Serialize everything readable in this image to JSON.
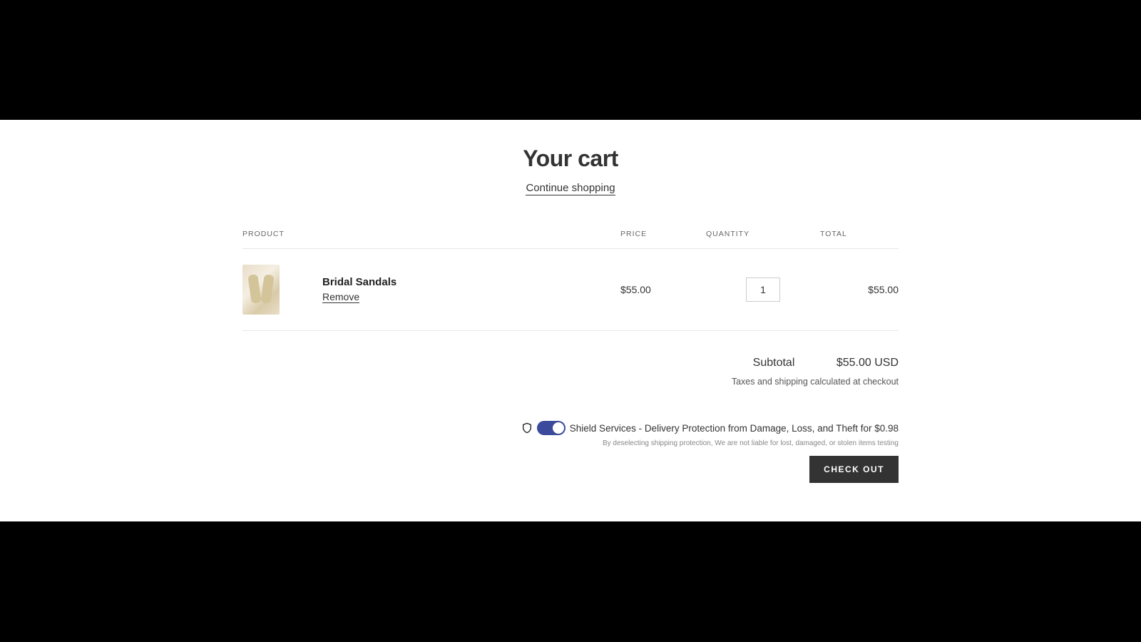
{
  "header": {
    "title": "Your cart",
    "continue_label": "Continue shopping"
  },
  "columns": {
    "product": "PRODUCT",
    "price": "PRICE",
    "quantity": "QUANTITY",
    "total": "TOTAL"
  },
  "items": [
    {
      "name": "Bridal Sandals",
      "remove_label": "Remove",
      "price": "$55.00",
      "quantity": "1",
      "total": "$55.00"
    }
  ],
  "summary": {
    "subtotal_label": "Subtotal",
    "subtotal_value": "$55.00 USD",
    "tax_note": "Taxes and shipping calculated at checkout"
  },
  "shield": {
    "label": "Shield Services - Delivery Protection from Damage, Loss, and Theft for $0.98",
    "fineprint": "By deselecting shipping protection, We are not liable for lost, damaged, or stolen items testing",
    "toggle_on": true
  },
  "checkout_label": "CHECK OUT"
}
